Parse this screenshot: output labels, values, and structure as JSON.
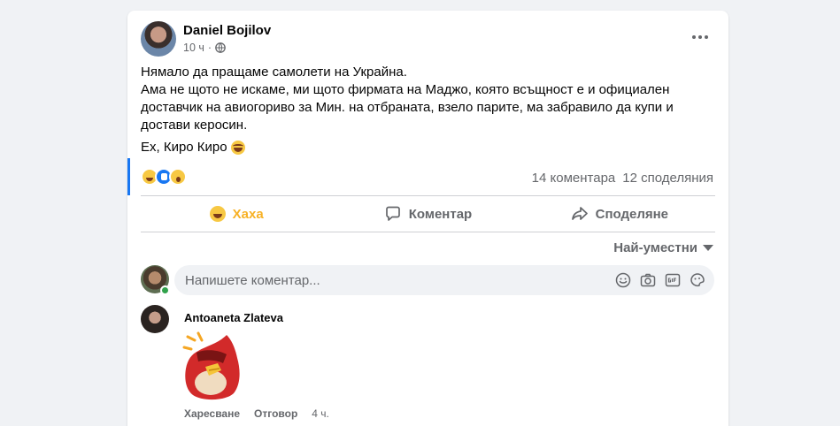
{
  "post": {
    "author": "Daniel Bojilov",
    "time": "10 ч",
    "paragraph1_line1": "Нямало да пращаме самолети на Украйна.",
    "paragraph1_line2": "Ама не щото не искаме, ми щото фирмата на Маджо, която всъщност е и официален доставчик на авиогориво за Мин. на отбраната, взело парите, ма забравило да купи и достави керосин.",
    "paragraph2": "Ех, Киро Киро",
    "comments_count": "14 коментара",
    "shares_count": "12 споделяния"
  },
  "actions": {
    "haha": "Хаха",
    "comment": "Коментар",
    "share": "Споделяне"
  },
  "sort": {
    "label": "Най-уместни"
  },
  "composer": {
    "placeholder": "Напишете коментар..."
  },
  "comment": {
    "author": "Antoaneta Zlateva",
    "like": "Харесване",
    "reply": "Отговор",
    "time": "4 ч."
  },
  "icons": {
    "reactions": [
      "haha-icon",
      "like-icon",
      "wow-icon"
    ],
    "composer_tools": [
      "emoji-icon",
      "camera-icon",
      "gif-icon",
      "sticker-icon"
    ]
  },
  "colors": {
    "haha_active": "#f7b125",
    "online": "#31a24c",
    "accent": "#1877f2"
  }
}
